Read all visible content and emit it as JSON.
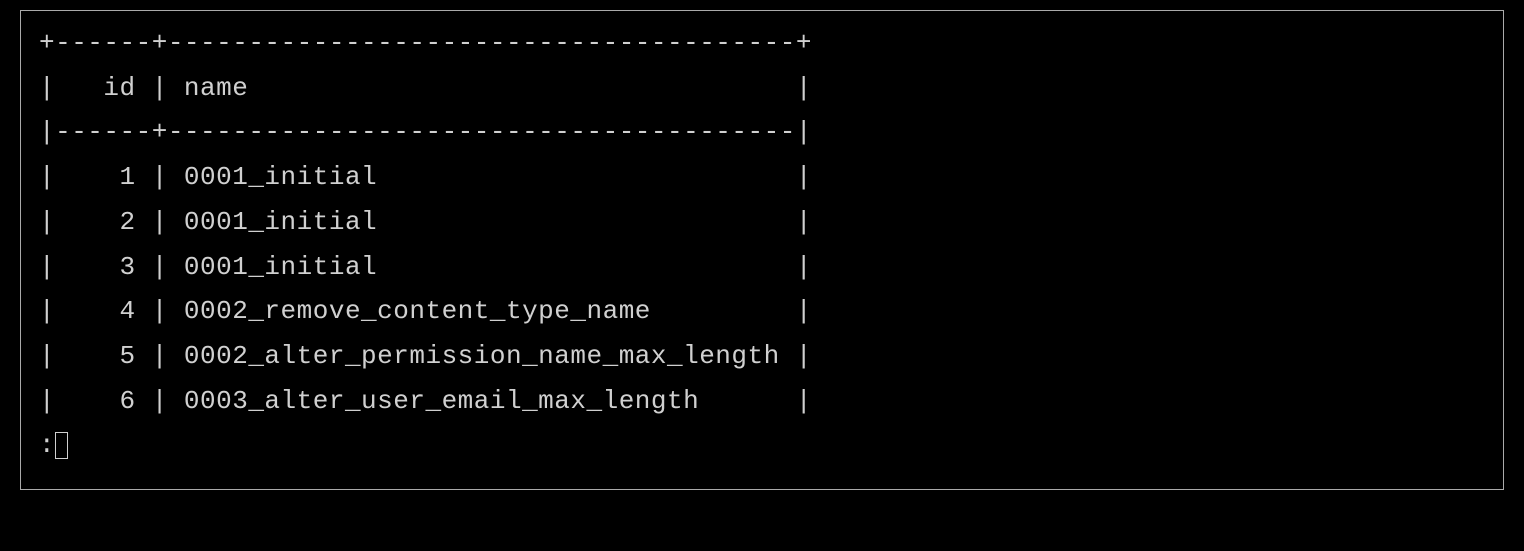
{
  "table": {
    "id_col_width": 6,
    "name_col_width": 39,
    "headers": {
      "id": "id",
      "name": "name"
    },
    "rows": [
      {
        "id": 1,
        "name": "0001_initial"
      },
      {
        "id": 2,
        "name": "0001_initial"
      },
      {
        "id": 3,
        "name": "0001_initial"
      },
      {
        "id": 4,
        "name": "0002_remove_content_type_name"
      },
      {
        "id": 5,
        "name": "0002_alter_permission_name_max_length"
      },
      {
        "id": 6,
        "name": "0003_alter_user_email_max_length"
      }
    ]
  },
  "prompt": ":"
}
